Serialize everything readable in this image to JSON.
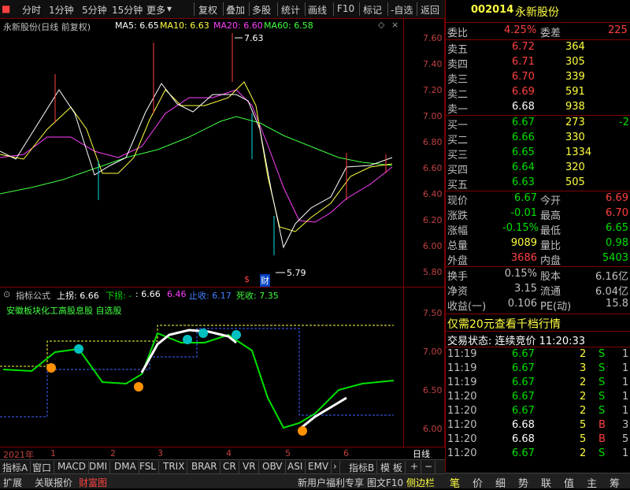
{
  "toolbar": {
    "items": [
      "分时",
      "1分钟",
      "5分钟",
      "15分钟",
      "更多",
      "复权",
      "叠加",
      "多股",
      "统计",
      "画线",
      "F10",
      "标记",
      "-自选",
      "返回"
    ]
  },
  "main_chart": {
    "title": "永新股份(日线 前复权)",
    "ma5": "MA5: 6.65",
    "ma10": "MA10: 6.63",
    "ma20": "MA20: 6.60",
    "ma60": "MA60: 6.58",
    "high_label": "7.63",
    "low_label": "5.79",
    "marker_s": "$",
    "marker_cai": "财",
    "y_ticks": [
      "7.60",
      "7.40",
      "7.20",
      "7.00",
      "6.80",
      "6.60",
      "6.40",
      "6.20",
      "6.00",
      "5.80"
    ]
  },
  "sub_chart": {
    "title": "指标公式",
    "shang_tuo": "上拐: 6.66",
    "xia_tuo": "下拐: -",
    "val_a": ": 6.66",
    "val_b": "6.46",
    "zhi_shou": "止收: 6.17",
    "si_shou": "死收: 7.35",
    "tags": "安徽板块化工高股息股 自选股",
    "y_ticks": [
      "7.50",
      "7.00",
      "6.50",
      "6.00"
    ]
  },
  "date_bar": {
    "year": "2021年",
    "months": [
      "1",
      "2",
      "3",
      "4",
      "5",
      "6"
    ],
    "period": "日线"
  },
  "tabs": [
    "指标A",
    "窗口",
    "MACD",
    "DMI",
    "DMA",
    "FSL",
    "TRIX",
    "BRAR",
    "CR",
    "VR",
    "OBV",
    "ASI",
    "EMV",
    "指标B",
    "模 板"
  ],
  "status_bar": {
    "left": [
      "扩展",
      "关联报价",
      "财富图"
    ],
    "right": [
      "新用户福利专享",
      "图文F10",
      "侧边栏"
    ]
  },
  "quote": {
    "code": "002014",
    "name": "永新股份",
    "weibi_label": "委比",
    "weibi": "4.25%",
    "weicha_label": "委差",
    "weicha": "225",
    "sells": [
      {
        "label": "卖五",
        "price": "6.72",
        "vol": "364"
      },
      {
        "label": "卖四",
        "price": "6.71",
        "vol": "305"
      },
      {
        "label": "卖三",
        "price": "6.70",
        "vol": "339"
      },
      {
        "label": "卖二",
        "price": "6.69",
        "vol": "591"
      },
      {
        "label": "卖一",
        "price": "6.68",
        "vol": "938"
      }
    ],
    "buys": [
      {
        "label": "买一",
        "price": "6.67",
        "vol": "273",
        "chg": "-2"
      },
      {
        "label": "买二",
        "price": "6.66",
        "vol": "330",
        "chg": ""
      },
      {
        "label": "买三",
        "price": "6.65",
        "vol": "1334",
        "chg": ""
      },
      {
        "label": "买四",
        "price": "6.64",
        "vol": "320",
        "chg": ""
      },
      {
        "label": "买五",
        "price": "6.63",
        "vol": "505",
        "chg": ""
      }
    ],
    "stats_left": [
      {
        "label": "现价",
        "value": "6.67",
        "color": "#00e000"
      },
      {
        "label": "涨跌",
        "value": "-0.01",
        "color": "#00e000"
      },
      {
        "label": "涨幅",
        "value": "-0.15%",
        "color": "#00e000"
      },
      {
        "label": "总量",
        "value": "9089",
        "color": "#ffff40"
      },
      {
        "label": "外盘",
        "value": "3686",
        "color": "#ff4040"
      }
    ],
    "stats_right": [
      {
        "label": "今开",
        "value": "6.69",
        "color": "#ff4040"
      },
      {
        "label": "最高",
        "value": "6.70",
        "color": "#ff4040"
      },
      {
        "label": "最低",
        "value": "6.65",
        "color": "#00e000"
      },
      {
        "label": "量比",
        "value": "0.98",
        "color": "#00e000"
      },
      {
        "label": "内盘",
        "value": "5403",
        "color": "#00e000"
      }
    ],
    "stats2_left": [
      {
        "label": "换手",
        "value": "0.15%"
      },
      {
        "label": "净资",
        "value": "3.15"
      },
      {
        "label": "收益(一)",
        "value": "0.106"
      }
    ],
    "stats2_right": [
      {
        "label": "股本",
        "value": "6.16亿"
      },
      {
        "label": "流通",
        "value": "6.04亿"
      },
      {
        "label": "PE(动)",
        "value": "15.8"
      }
    ],
    "promo": "仅需20元查看千档行情",
    "trade_status": "交易状态: 连续竞价 11:20:33",
    "ticks": [
      {
        "time": "11:19",
        "price": "6.67",
        "vol": "2",
        "side": "S",
        "n": "1",
        "pc": "#00e000",
        "sc": "#00e000"
      },
      {
        "time": "11:19",
        "price": "6.67",
        "vol": "3",
        "side": "S",
        "n": "1",
        "pc": "#00e000",
        "sc": "#00e000"
      },
      {
        "time": "11:19",
        "price": "6.67",
        "vol": "2",
        "side": "S",
        "n": "1",
        "pc": "#00e000",
        "sc": "#00e000"
      },
      {
        "time": "11:20",
        "price": "6.67",
        "vol": "2",
        "side": "S",
        "n": "1",
        "pc": "#00e000",
        "sc": "#00e000"
      },
      {
        "time": "11:20",
        "price": "6.67",
        "vol": "2",
        "side": "S",
        "n": "1",
        "pc": "#00e000",
        "sc": "#00e000"
      },
      {
        "time": "11:20",
        "price": "6.68",
        "vol": "5",
        "side": "B",
        "n": "3",
        "pc": "#ffffff",
        "sc": "#ff4040"
      },
      {
        "time": "11:20",
        "price": "6.68",
        "vol": "5",
        "side": "B",
        "n": "5",
        "pc": "#ffffff",
        "sc": "#ff4040"
      },
      {
        "time": "11:20",
        "price": "6.67",
        "vol": "2",
        "side": "S",
        "n": "1",
        "pc": "#00e000",
        "sc": "#00e000"
      }
    ],
    "bottom_tabs": [
      "笔",
      "价",
      "细",
      "势",
      "联",
      "值",
      "主",
      "筹"
    ]
  },
  "colors": {
    "up": "#ff4040",
    "down": "#00e000",
    "ma5": "#ffffff",
    "ma10": "#ffff40",
    "ma20": "#ff40ff",
    "ma60": "#40ff40",
    "axis": "#800000"
  }
}
